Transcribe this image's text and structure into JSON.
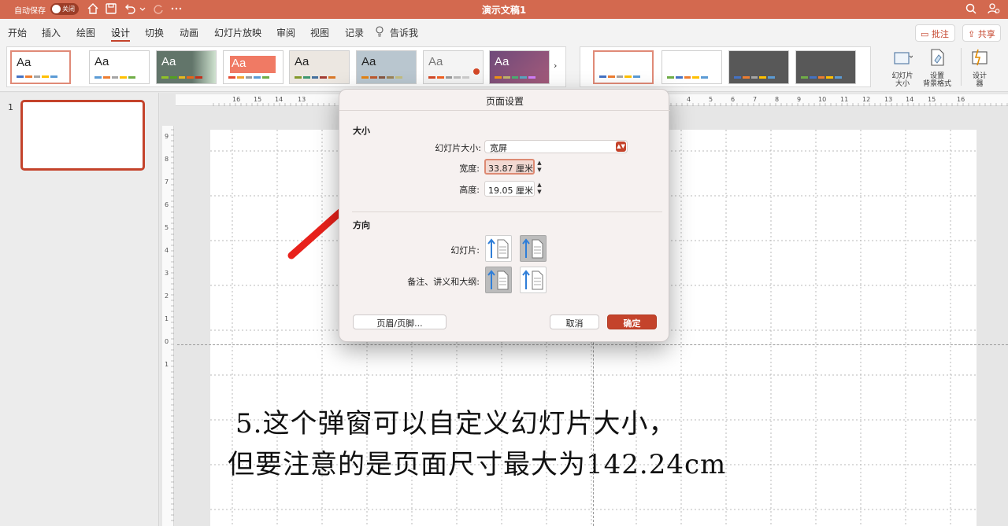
{
  "titlebar": {
    "autosave_label": "自动保存",
    "autosave_state": "关闭",
    "doc_title": "演示文稿1",
    "accent_color": "#d3694f"
  },
  "menu": {
    "tabs": [
      "开始",
      "插入",
      "绘图",
      "设计",
      "切换",
      "动画",
      "幻灯片放映",
      "审阅",
      "视图",
      "记录",
      "告诉我"
    ],
    "active_tab": "设计",
    "comment_label": "批注",
    "share_label": "共享"
  },
  "ribbon": {
    "theme_label": "Aa",
    "slide_size_label_1": "幻灯片",
    "slide_size_label_2": "大小",
    "format_bg_label_1": "设置",
    "format_bg_label_2": "背景格式",
    "designer_label_1": "设计",
    "designer_label_2": "器"
  },
  "thumbnails": {
    "slide_number": "1"
  },
  "rulers": {
    "h_ticks": [
      "16",
      "15",
      "14",
      "13",
      "4",
      "5",
      "6",
      "7",
      "8",
      "9",
      "10",
      "11",
      "12",
      "13",
      "14",
      "15",
      "16"
    ],
    "v_ticks": [
      "9",
      "8",
      "7",
      "6",
      "5",
      "4",
      "3",
      "2",
      "1",
      "0",
      "1"
    ]
  },
  "dialog": {
    "title": "页面设置",
    "size_section": "大小",
    "slide_size_label": "幻灯片大小:",
    "slide_size_value": "宽屏",
    "width_label": "宽度:",
    "width_value": "33.87 厘米",
    "height_label": "高度:",
    "height_value": "19.05 厘米",
    "orientation_section": "方向",
    "slides_label": "幻灯片:",
    "notes_label": "备注、讲义和大纲:",
    "header_footer_button": "页眉/页脚...",
    "cancel_button": "取消",
    "ok_button": "确定"
  },
  "annotation": {
    "line1": "5.这个弹窗可以自定义幻灯片大小，",
    "line2": "但要注意的是页面尺寸最大为142.24cm"
  }
}
